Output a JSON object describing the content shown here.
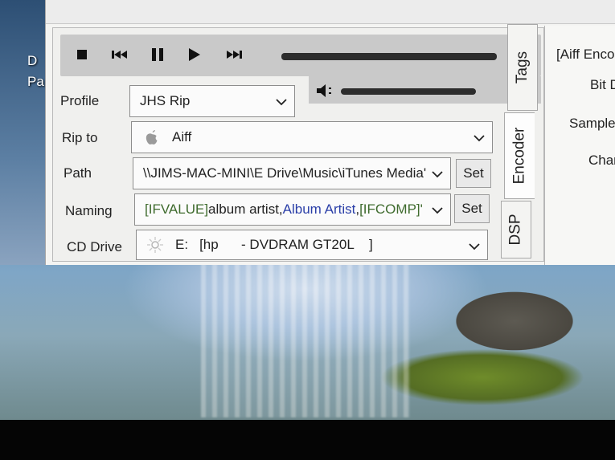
{
  "desktop": {
    "icon_label_1": "D",
    "icon_label_2": "Pa"
  },
  "transport": {
    "stop": "stop-icon",
    "previous": "skip-back-icon",
    "pause": "pause-icon",
    "play": "play-icon",
    "next": "skip-forward-icon",
    "volume": "speaker-icon"
  },
  "fields": {
    "profile": {
      "label": "Profile",
      "value": "JHS Rip"
    },
    "rip_to": {
      "label": "Rip to",
      "value": "Aiff"
    },
    "path": {
      "label": "Path",
      "value": "\\\\JIMS-MAC-MINI\\E Drive\\Music\\iTunes Media'",
      "set": "Set"
    },
    "naming": {
      "label": "Naming",
      "value_part1": "[IFVALUE]",
      "value_part2": "album artist,",
      "value_part3": "Album Artist",
      "value_part4": ",",
      "value_part5": "[IFCOMP]'",
      "set": "Set"
    },
    "cd_drive": {
      "label": "CD Drive",
      "letter": "E:",
      "value": "[hp      - DVDRAM GT20L    ]"
    }
  },
  "tabs": [
    "Tags",
    "Encoder",
    "DSP"
  ],
  "right_panel": {
    "header": "[Aiff Enco",
    "bit_depth": "Bit D",
    "sample": "Sample",
    "channels": "Char"
  },
  "colors": {
    "naming_keyword": "#3f6b2e",
    "naming_field": "#2b3fa8"
  }
}
